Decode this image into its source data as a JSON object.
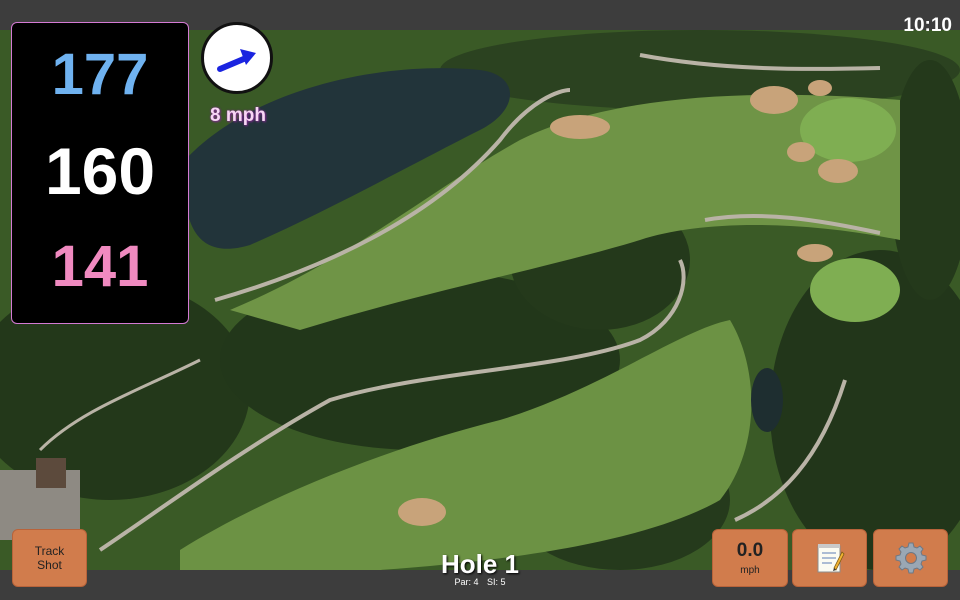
{
  "status": {
    "time": "10:10"
  },
  "distances": {
    "front": "177",
    "middle": "160",
    "back": "141"
  },
  "wind": {
    "speed": "8 mph",
    "icon": "arrow-up-right-icon"
  },
  "buttons": {
    "track_shot_line1": "Track",
    "track_shot_line2": "Shot",
    "speed_value": "0.0",
    "speed_unit": "mph",
    "notes_icon": "notepad-icon",
    "settings_icon": "gear-icon"
  },
  "hole": {
    "title": "Hole 1",
    "par": "Par: 4",
    "si": "SI: 5"
  },
  "colors": {
    "front": "#6fb2f0",
    "middle": "#ffffff",
    "back": "#f08ac0",
    "button": "#d17c4c",
    "wind_text": "#f7d6f4"
  }
}
